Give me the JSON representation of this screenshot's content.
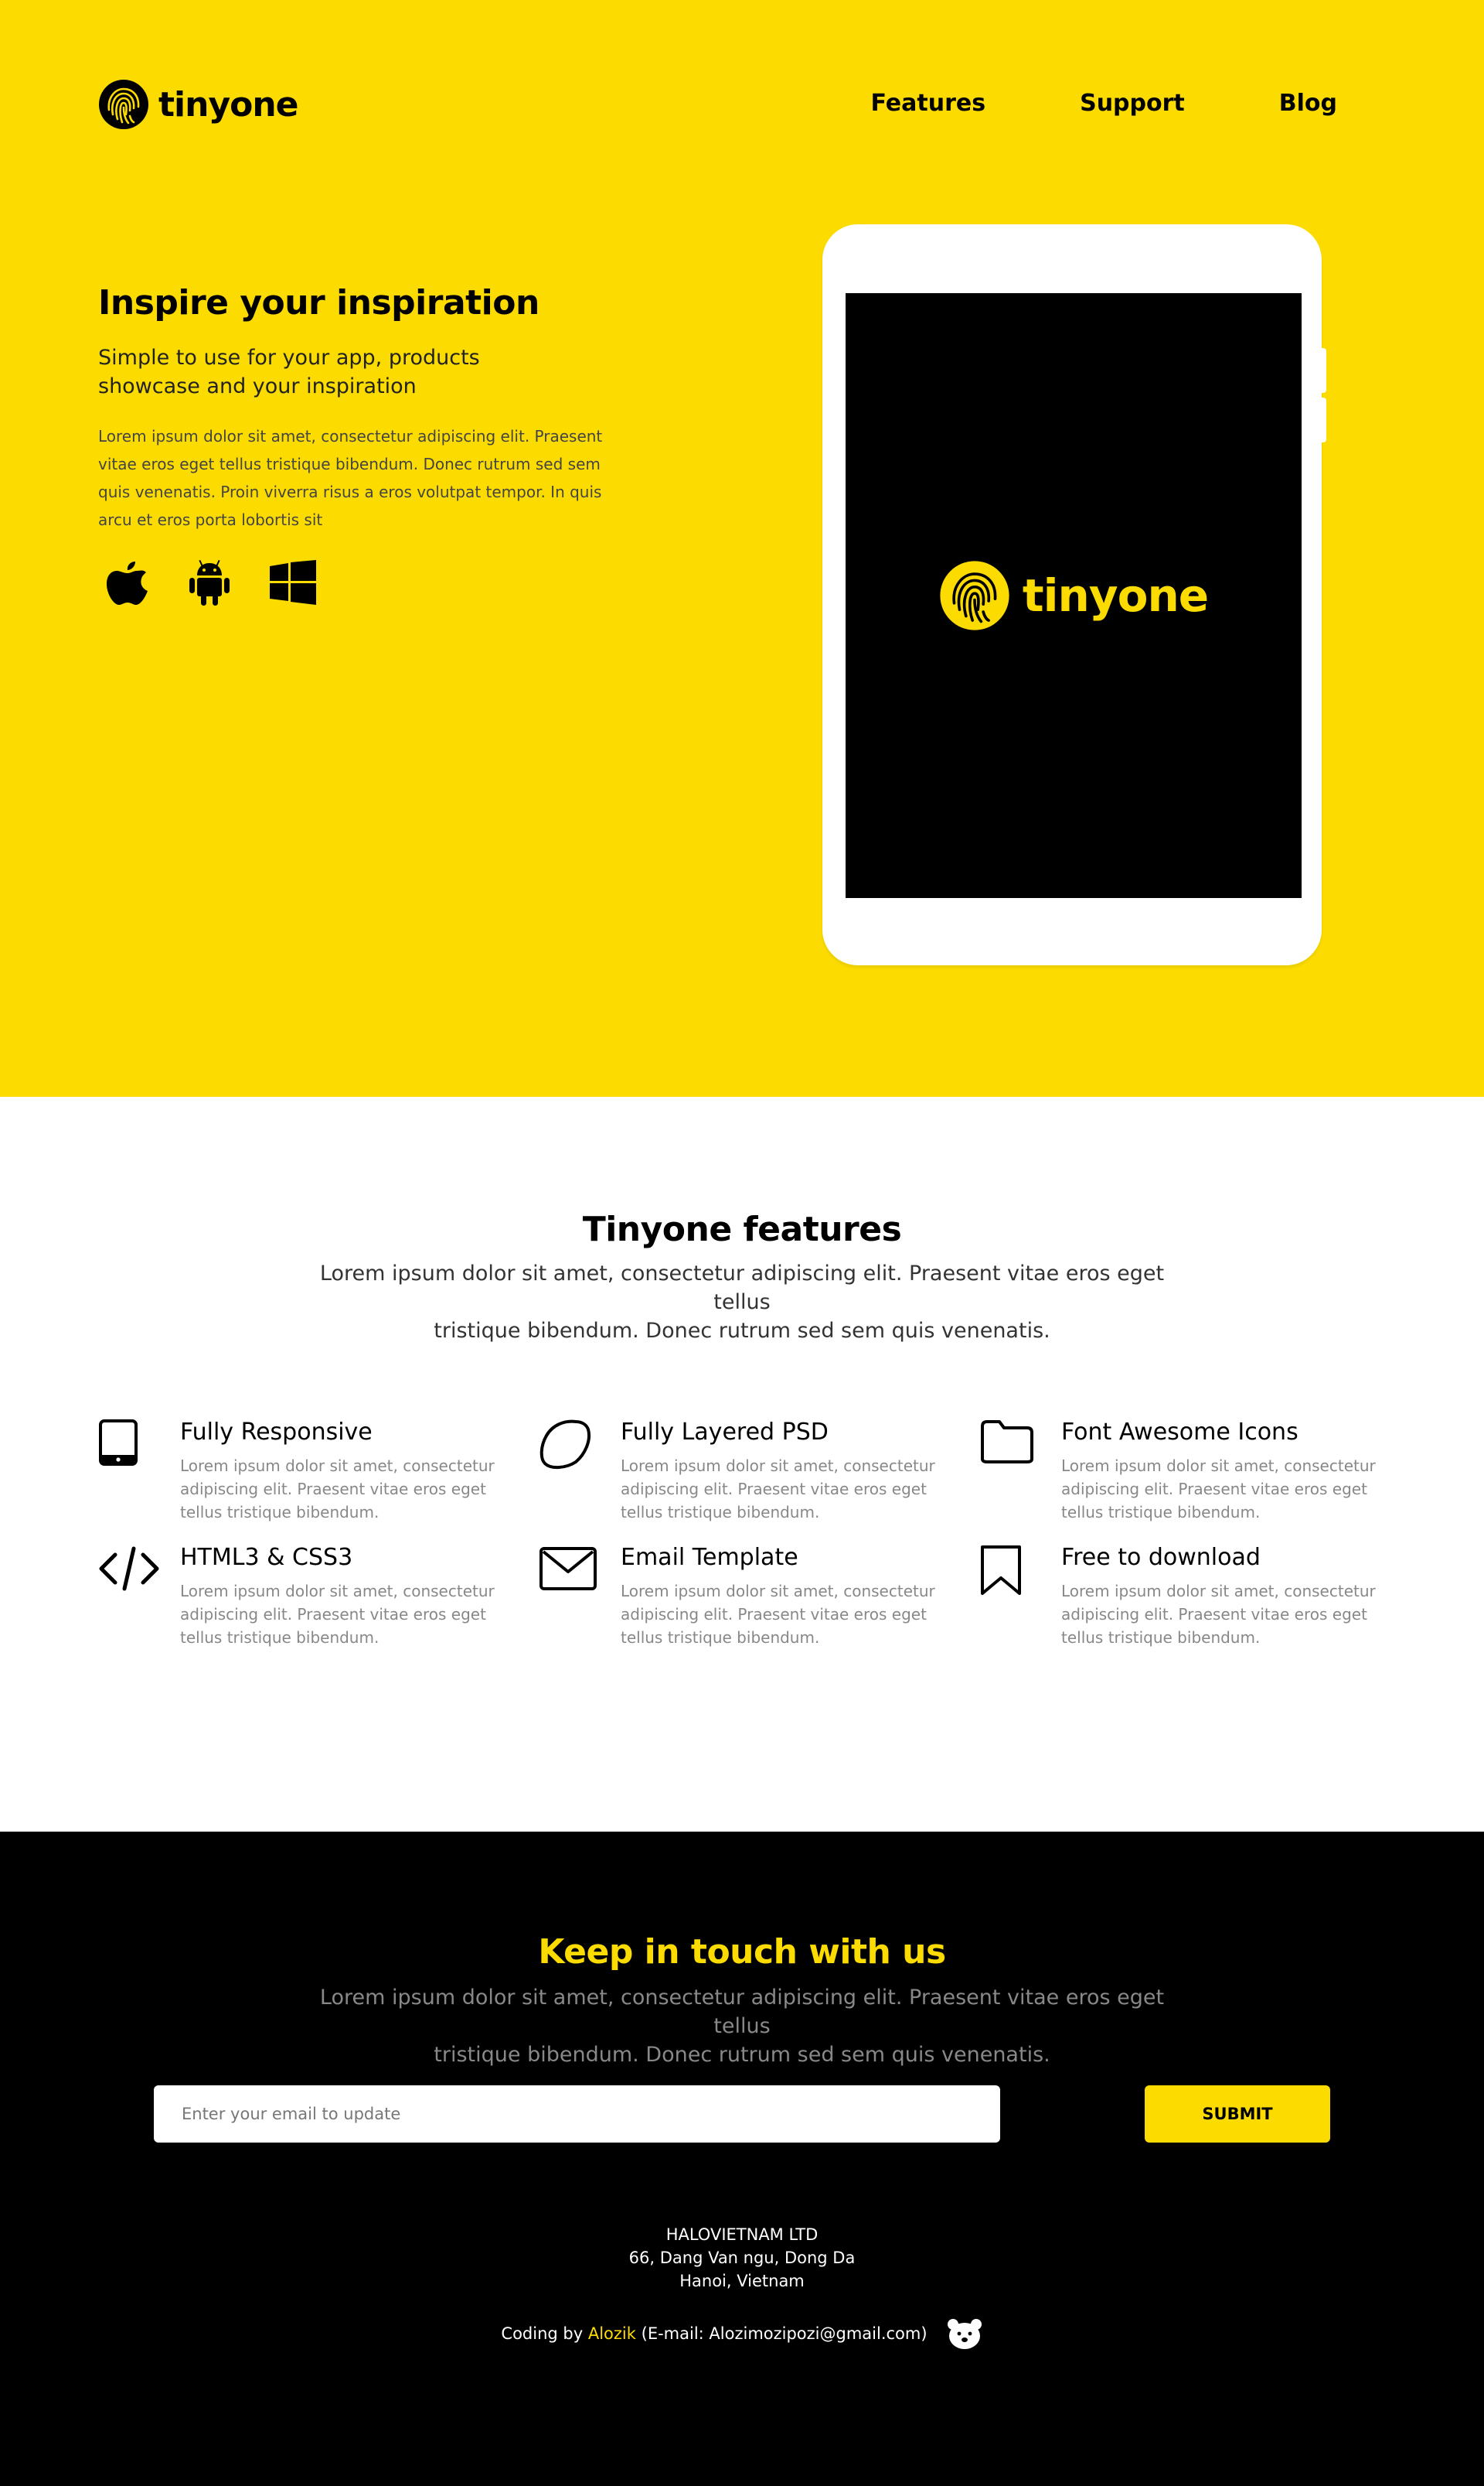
{
  "header": {
    "brand": "tinyone",
    "nav": [
      {
        "label": "Features"
      },
      {
        "label": "Support"
      },
      {
        "label": "Blog"
      }
    ]
  },
  "hero": {
    "title": "Inspire your inspiration",
    "subtitle_line1": "Simple to use for your app, products",
    "subtitle_line2": "showcase and your inspiration",
    "body_line1": "Lorem ipsum dolor sit amet, consectetur adipiscing elit. Praesent",
    "body_line2": "vitae eros eget tellus tristique bibendum. Donec rutrum sed sem",
    "body_line3": "quis venenatis. Proin viverra risus a eros volutpat tempor. In quis",
    "body_line4": "arcu et eros porta lobortis sit",
    "platform_icons": [
      "apple-icon",
      "android-icon",
      "windows-icon"
    ],
    "tablet_brand": "tinyone"
  },
  "features": {
    "title": "Tinyone features",
    "intro_line1": "Lorem ipsum dolor sit amet, consectetur adipiscing elit. Praesent vitae eros eget tellus",
    "intro_line2": "tristique bibendum. Donec rutrum sed sem quis venenatis.",
    "items": [
      {
        "icon": "tablet-icon",
        "title": "Fully Responsive",
        "desc": "Lorem ipsum dolor sit amet, consectetur adipiscing elit. Praesent vitae eros eget tellus tristique bibendum."
      },
      {
        "icon": "lemon-icon",
        "title": "Fully Layered PSD",
        "desc": "Lorem ipsum dolor sit amet, consectetur adipiscing elit. Praesent vitae eros eget tellus tristique bibendum."
      },
      {
        "icon": "folder-icon",
        "title": "Font Awesome Icons",
        "desc": "Lorem ipsum dolor sit amet, consectetur adipiscing elit. Praesent vitae eros eget tellus tristique bibendum."
      },
      {
        "icon": "code-icon",
        "title": "HTML3 & CSS3",
        "desc": "Lorem ipsum dolor sit amet, consectetur adipiscing elit. Praesent vitae eros eget tellus tristique bibendum."
      },
      {
        "icon": "envelope-icon",
        "title": "Email Template",
        "desc": "Lorem ipsum dolor sit amet, consectetur adipiscing elit. Praesent vitae eros eget tellus tristique bibendum."
      },
      {
        "icon": "bookmark-icon",
        "title": "Free to download",
        "desc": "Lorem ipsum dolor sit amet, consectetur adipiscing elit. Praesent vitae eros eget tellus tristique bibendum."
      }
    ]
  },
  "contact": {
    "title": "Keep in touch with us",
    "intro_line1": "Lorem ipsum dolor sit amet, consectetur adipiscing elit. Praesent vitae eros eget tellus",
    "intro_line2": "tristique bibendum. Donec rutrum sed sem quis venenatis.",
    "email_placeholder": "Enter your email to update",
    "email_value": "",
    "submit_label": "SUBMIT"
  },
  "footer": {
    "company": "HALOVIETNAM LTD",
    "address_line1": "66, Dang Van ngu, Dong Da",
    "address_line2": "Hanoi, Vietnam",
    "credit_prefix": "Coding by",
    "credit_name": "Alozik",
    "credit_email": "(E-mail: Alozimozipozi@gmail.com)"
  },
  "colors": {
    "brand_yellow": "#fcdc00",
    "black": "#000000",
    "white": "#ffffff",
    "muted_gray": "#888888"
  }
}
